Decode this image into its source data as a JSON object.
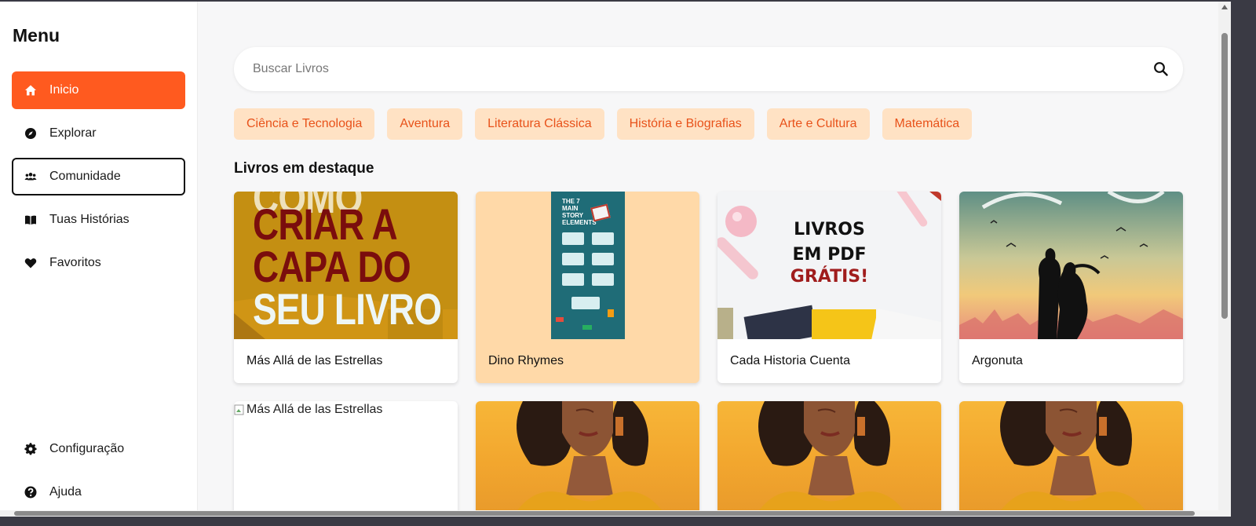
{
  "sidebar": {
    "title": "Menu",
    "items": [
      {
        "label": "Inicio",
        "icon": "home-icon",
        "state": "active"
      },
      {
        "label": "Explorar",
        "icon": "compass-icon",
        "state": "normal"
      },
      {
        "label": "Comunidade",
        "icon": "users-icon",
        "state": "focused"
      },
      {
        "label": "Tuas Histórias",
        "icon": "book-icon",
        "state": "normal"
      },
      {
        "label": "Favoritos",
        "icon": "heart-icon",
        "state": "normal"
      }
    ],
    "bottom_items": [
      {
        "label": "Configuração",
        "icon": "gear-icon"
      },
      {
        "label": "Ajuda",
        "icon": "help-icon"
      }
    ]
  },
  "search": {
    "placeholder": "Buscar Livros",
    "icon": "search-icon"
  },
  "categories": [
    "Ciência e Tecnologia",
    "Aventura",
    "Literatura Clássica",
    "História e Biografias",
    "Arte e Cultura",
    "Matemática"
  ],
  "featured": {
    "title": "Livros em destaque",
    "books": [
      {
        "title": "Más Allá de las Estrellas",
        "cover_text": [
          "CRIAR A",
          "CAPA DO",
          "SEU LIVRO"
        ]
      },
      {
        "title": "Dino Rhymes",
        "cover_text": [
          "THE 7",
          "MAIN",
          "STORY",
          "ELEMENTS"
        ]
      },
      {
        "title": "Cada Historia Cuenta",
        "cover_text": [
          "LIVROS",
          "EM PDF",
          "GRÁTIS!"
        ]
      },
      {
        "title": "Argonuta"
      }
    ],
    "row2": [
      {
        "alt": "Más Allá de las Estrellas",
        "image_broken": true
      },
      {
        "image": "woman-portrait"
      },
      {
        "image": "woman-portrait"
      },
      {
        "image": "woman-portrait"
      }
    ]
  },
  "colors": {
    "accent": "#ff5a1f",
    "chip_bg": "#ffe2c4",
    "chip_text": "#e8521a",
    "highlight_card": "#ffd9a8"
  }
}
